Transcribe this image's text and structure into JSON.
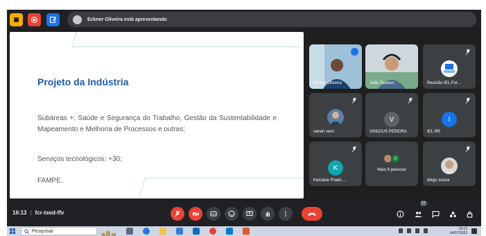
{
  "meet": {
    "presenting_text": "Eckner Oliveira está apresentando",
    "time": "16:13",
    "meeting_code": "fcr-tsed-ffv",
    "participant_count": "17",
    "colors": {
      "mic_off": "#ea4335",
      "tile_bg": "#3c4043",
      "accent": "#1a73e8"
    }
  },
  "slide": {
    "title": "Projeto da Indústria",
    "paragraph1": "Subáreas +: Saúde e Segurança do Trabalho, Gestão da Sustentabilidade e Mapeamento e Melhoria de Processos e outras;",
    "paragraph2": "Serviços tecnológicos: +30;",
    "paragraph3": "FAMPE."
  },
  "participants": [
    {
      "name": "Eckner Oliveira",
      "type": "video",
      "active": true
    },
    {
      "name": "João Tavares",
      "type": "video"
    },
    {
      "name": "Reunião IEL-For...",
      "type": "photo"
    },
    {
      "name": "vaneri verri",
      "type": "photo"
    },
    {
      "name": "VINICIUS PEREIRA",
      "type": "initial",
      "initial": "V",
      "color": "#5f6368"
    },
    {
      "name": "IEL RR",
      "type": "initial",
      "initial": "I",
      "color": "#1a73e8"
    },
    {
      "name": "Keiciane Prado ...",
      "type": "initial",
      "initial": "K",
      "color": "#12a4af"
    },
    {
      "name": "Mais 8 pessoas",
      "type": "group",
      "initial": "A",
      "color": "#188038"
    },
    {
      "name": "diego souza",
      "type": "photo"
    }
  ],
  "taskbar": {
    "search_placeholder": "Pesquisar",
    "clock_time": "16:13",
    "clock_date": "04/07/2023"
  }
}
